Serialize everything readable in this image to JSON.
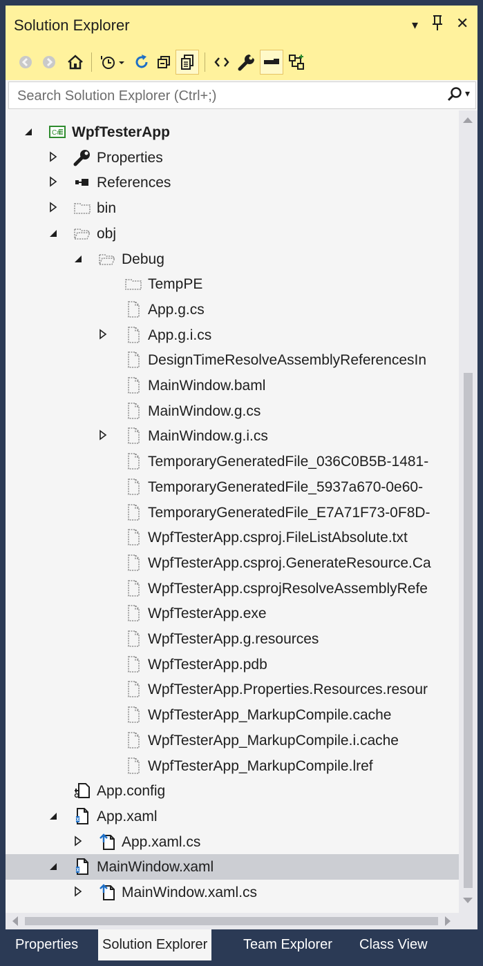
{
  "window": {
    "title": "Solution Explorer",
    "dropdown_glyph": "▾",
    "pin_glyph": "ㅍ",
    "close_glyph": "✕"
  },
  "toolbar": {
    "buttons": [
      {
        "name": "back-icon"
      },
      {
        "name": "forward-icon"
      },
      {
        "name": "home-icon"
      },
      {
        "name": "pending-changes-filter-icon"
      },
      {
        "name": "sync-with-active-document-icon"
      },
      {
        "name": "collapse-all-icon"
      },
      {
        "name": "show-all-files-icon",
        "active": true
      },
      {
        "name": "code-view-icon"
      },
      {
        "name": "properties-wrench-icon"
      },
      {
        "name": "preview-selected-items-icon",
        "active": true
      },
      {
        "name": "view-class-diagram-icon"
      }
    ]
  },
  "search": {
    "placeholder": "Search Solution Explorer (Ctrl+;)"
  },
  "tree": {
    "items": [
      {
        "label": "WpfTesterApp",
        "bold": true,
        "expander": "expanded",
        "icon": "csharp-project-icon",
        "level": 0
      },
      {
        "label": "Properties",
        "expander": "collapsed",
        "icon": "wrench-icon",
        "level": 1
      },
      {
        "label": "References",
        "expander": "collapsed",
        "icon": "references-icon",
        "level": 1
      },
      {
        "label": "bin",
        "expander": "collapsed",
        "icon": "folder-icon",
        "level": 1
      },
      {
        "label": "obj",
        "expander": "expanded",
        "icon": "folder-open-icon",
        "level": 1
      },
      {
        "label": "Debug",
        "expander": "expanded",
        "icon": "folder-open-icon",
        "level": 2
      },
      {
        "label": "TempPE",
        "expander": "none",
        "icon": "folder-icon",
        "level": 3
      },
      {
        "label": "App.g.cs",
        "expander": "none",
        "icon": "file-icon",
        "level": 3
      },
      {
        "label": "App.g.i.cs",
        "expander": "collapsed",
        "icon": "file-icon",
        "level": 3
      },
      {
        "label": "DesignTimeResolveAssemblyReferencesIn",
        "expander": "none",
        "icon": "file-icon",
        "level": 3
      },
      {
        "label": "MainWindow.baml",
        "expander": "none",
        "icon": "file-icon",
        "level": 3
      },
      {
        "label": "MainWindow.g.cs",
        "expander": "none",
        "icon": "file-icon",
        "level": 3
      },
      {
        "label": "MainWindow.g.i.cs",
        "expander": "collapsed",
        "icon": "file-icon",
        "level": 3
      },
      {
        "label": "TemporaryGeneratedFile_036C0B5B-1481-",
        "expander": "none",
        "icon": "file-icon",
        "level": 3
      },
      {
        "label": "TemporaryGeneratedFile_5937a670-0e60-",
        "expander": "none",
        "icon": "file-icon",
        "level": 3
      },
      {
        "label": "TemporaryGeneratedFile_E7A71F73-0F8D-",
        "expander": "none",
        "icon": "file-icon",
        "level": 3
      },
      {
        "label": "WpfTesterApp.csproj.FileListAbsolute.txt",
        "expander": "none",
        "icon": "file-icon",
        "level": 3
      },
      {
        "label": "WpfTesterApp.csproj.GenerateResource.Ca",
        "expander": "none",
        "icon": "file-icon",
        "level": 3
      },
      {
        "label": "WpfTesterApp.csprojResolveAssemblyRefe",
        "expander": "none",
        "icon": "file-icon",
        "level": 3
      },
      {
        "label": "WpfTesterApp.exe",
        "expander": "none",
        "icon": "file-icon",
        "level": 3
      },
      {
        "label": "WpfTesterApp.g.resources",
        "expander": "none",
        "icon": "file-icon",
        "level": 3
      },
      {
        "label": "WpfTesterApp.pdb",
        "expander": "none",
        "icon": "file-icon",
        "level": 3
      },
      {
        "label": "WpfTesterApp.Properties.Resources.resour",
        "expander": "none",
        "icon": "file-icon",
        "level": 3
      },
      {
        "label": "WpfTesterApp_MarkupCompile.cache",
        "expander": "none",
        "icon": "file-icon",
        "level": 3
      },
      {
        "label": "WpfTesterApp_MarkupCompile.i.cache",
        "expander": "none",
        "icon": "file-icon",
        "level": 3
      },
      {
        "label": "WpfTesterApp_MarkupCompile.lref",
        "expander": "none",
        "icon": "file-icon",
        "level": 3
      },
      {
        "label": "App.config",
        "expander": "none",
        "icon": "config-file-icon",
        "level": 1
      },
      {
        "label": "App.xaml",
        "expander": "expanded",
        "icon": "xaml-file-icon",
        "level": 1
      },
      {
        "label": "App.xaml.cs",
        "expander": "collapsed",
        "icon": "csharp-file-icon",
        "level": 2
      },
      {
        "label": "MainWindow.xaml",
        "expander": "expanded",
        "icon": "xaml-file-icon",
        "level": 1,
        "selected": true
      },
      {
        "label": "MainWindow.xaml.cs",
        "expander": "collapsed",
        "icon": "csharp-file-icon",
        "level": 2
      }
    ]
  },
  "tabs": [
    {
      "label": "Properties",
      "active": false
    },
    {
      "label": "Solution Explorer",
      "active": true
    },
    {
      "label": "Team Explorer",
      "active": false
    },
    {
      "label": "Class View",
      "active": false
    }
  ],
  "colors": {
    "title_bar": "#fff29d",
    "panel_background": "#f5f5f5",
    "selection": "#ccced3",
    "tab_strip": "#2b3a55"
  }
}
